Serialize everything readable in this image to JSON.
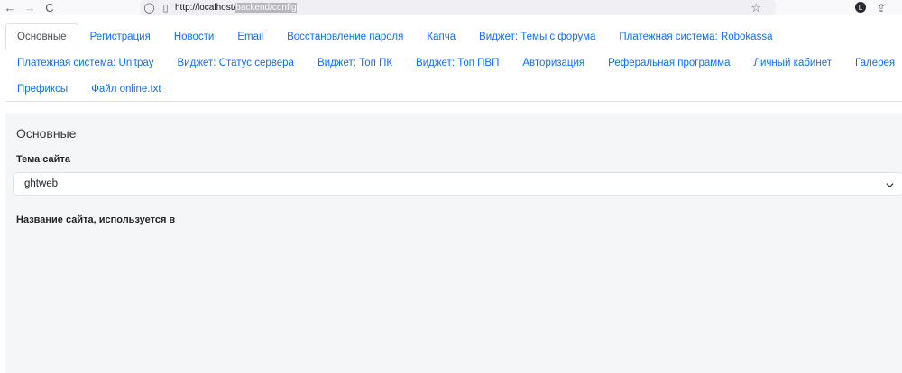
{
  "browser": {
    "url_prefix": "http://localhost/",
    "url_selected": "backend/config",
    "back_glyph": "←",
    "forward_glyph": "→",
    "reload_glyph": "C",
    "shield_glyph": "◯",
    "page_glyph": "▯",
    "star_glyph": "☆",
    "profile_letter": "L",
    "ext_glyph": "⇪"
  },
  "tabs": {
    "row1": [
      "Основные",
      "Регистрация",
      "Новости",
      "Email",
      "Восстановление пароля",
      "Капча",
      "Виджет: Темы с форума",
      "Платежная система: Robokassa"
    ],
    "row2": [
      "Платежная система: Unitpay",
      "Виджет: Статус сервера",
      "Виджет: Топ ПК",
      "Виджет: Топ ПВП",
      "Авторизация",
      "Реферальная программа",
      "Личный кабинет",
      "Галерея"
    ],
    "row3": [
      "Префиксы",
      "Файл online.txt"
    ]
  },
  "panel": {
    "title": "Основные",
    "theme_label": "Тема сайта",
    "theme_value": "ghtweb",
    "site_name_label": "Название сайта, используется в"
  },
  "colors": {
    "link": "#0d6efd",
    "panel_bg": "#f5f6f7"
  },
  "icons": [
    "back-arrow-icon",
    "forward-arrow-icon",
    "reload-icon",
    "shield-icon",
    "page-icon",
    "star-icon",
    "profile-icon",
    "extension-icon",
    "chevron-down-icon"
  ]
}
